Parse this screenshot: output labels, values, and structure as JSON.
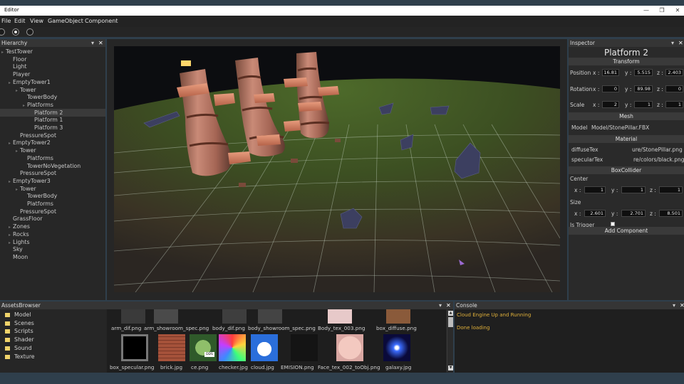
{
  "window": {
    "title": "Editor",
    "minimize": "—",
    "maximize": "❐",
    "close": "✕"
  },
  "menu": [
    "File",
    "Edit",
    "View",
    "GameObject",
    "Component"
  ],
  "hierarchy": {
    "title": "Hierarchy",
    "pin": "▾",
    "close": "✕",
    "items": [
      {
        "label": "TestTower",
        "depth": 0,
        "caret": true
      },
      {
        "label": "Floor",
        "depth": 1
      },
      {
        "label": "Light",
        "depth": 1
      },
      {
        "label": "Player",
        "depth": 1
      },
      {
        "label": "EmptyTower1",
        "depth": 1,
        "caret": true
      },
      {
        "label": "Tower",
        "depth": 2,
        "caret": true
      },
      {
        "label": "TowerBody",
        "depth": 3
      },
      {
        "label": "Platforms",
        "depth": 3,
        "caret": true
      },
      {
        "label": "Platform 2",
        "depth": 4,
        "selected": true
      },
      {
        "label": "Platform 1",
        "depth": 4
      },
      {
        "label": "Platform 3",
        "depth": 4
      },
      {
        "label": "PressureSpot",
        "depth": 2
      },
      {
        "label": "EmptyTower2",
        "depth": 1,
        "caret": true
      },
      {
        "label": "Tower",
        "depth": 2,
        "caret": true
      },
      {
        "label": "Platforms",
        "depth": 3
      },
      {
        "label": "TowerNoVegetation",
        "depth": 3
      },
      {
        "label": "PressureSpot",
        "depth": 2
      },
      {
        "label": "EmptyTower3",
        "depth": 1,
        "caret": true
      },
      {
        "label": "Tower",
        "depth": 2,
        "caret": true
      },
      {
        "label": "TowerBody",
        "depth": 3
      },
      {
        "label": "Platforms",
        "depth": 3
      },
      {
        "label": "PressureSpot",
        "depth": 2
      },
      {
        "label": "GrassFloor",
        "depth": 1
      },
      {
        "label": "Zones",
        "depth": 1,
        "caret": true
      },
      {
        "label": "Rocks",
        "depth": 1,
        "caret": true
      },
      {
        "label": "Lights",
        "depth": 1,
        "caret": true
      },
      {
        "label": "Sky",
        "depth": 1
      },
      {
        "label": "Moon",
        "depth": 1
      }
    ]
  },
  "inspector": {
    "title": "Inspector",
    "pin": "▾",
    "close": "✕",
    "object_name": "Platform 2",
    "transform": {
      "header": "Transform",
      "position": {
        "label": "Position",
        "x": "16.81",
        "y": "5.515",
        "z": "2.403"
      },
      "rotation": {
        "label": "Rotation",
        "x": "0",
        "y": "89.98",
        "z": "0"
      },
      "scale": {
        "label": "Scale",
        "x": "2",
        "y": "1",
        "z": "1"
      },
      "x_label": "x :",
      "y_label": "y :",
      "z_label": "z :"
    },
    "mesh": {
      "header": "Mesh",
      "model_label": "Model",
      "model_value": "Model/StonePillar.FBX"
    },
    "material": {
      "header": "Material",
      "diffuse_label": "diffuseTex",
      "diffuse_value": "ure/StonePillar.png",
      "specular_label": "specularTex",
      "specular_value": "re/colors/black.png"
    },
    "collider": {
      "header": "BoxCollider",
      "center_label": "Center",
      "center": {
        "x": "1",
        "y": "1",
        "z": "1"
      },
      "size_label": "Size",
      "size": {
        "x": "2.601",
        "y": "2.701",
        "z": "8.501"
      },
      "trigger_label": "Is Trigger",
      "is_trigger": false
    },
    "add_component": "Add Component"
  },
  "assets": {
    "title": "AssetsBrowser",
    "pin": "▾",
    "close": "✕",
    "folders": [
      "Model",
      "Scenes",
      "Scripts",
      "Shader",
      "Sound",
      "Texture"
    ],
    "row1": [
      "arm_dif.png",
      "arm_showroom_spec.png",
      "body_dif.png",
      "body_showroom_spec.png",
      "Body_tex_003.png",
      "box_diffuse.png"
    ],
    "row2": [
      "box_specular.png",
      "brick.jpg",
      "ce.png",
      "checker.jpg",
      "cloud.jpg",
      "EMISION.png",
      "Face_tex_002_toObj.png",
      "galaxy.jpg"
    ],
    "thumb_text_ce": "DDS"
  },
  "console": {
    "title": "Console",
    "pin": "▾",
    "close": "✕",
    "lines": [
      "Cloud Engine Up and Running",
      "Done loading"
    ]
  },
  "colors": {
    "accent_console": "#e0b03a",
    "panel_bg": "#272727",
    "header_bg": "#353535",
    "desktop_bg": "#2f3f4c"
  }
}
